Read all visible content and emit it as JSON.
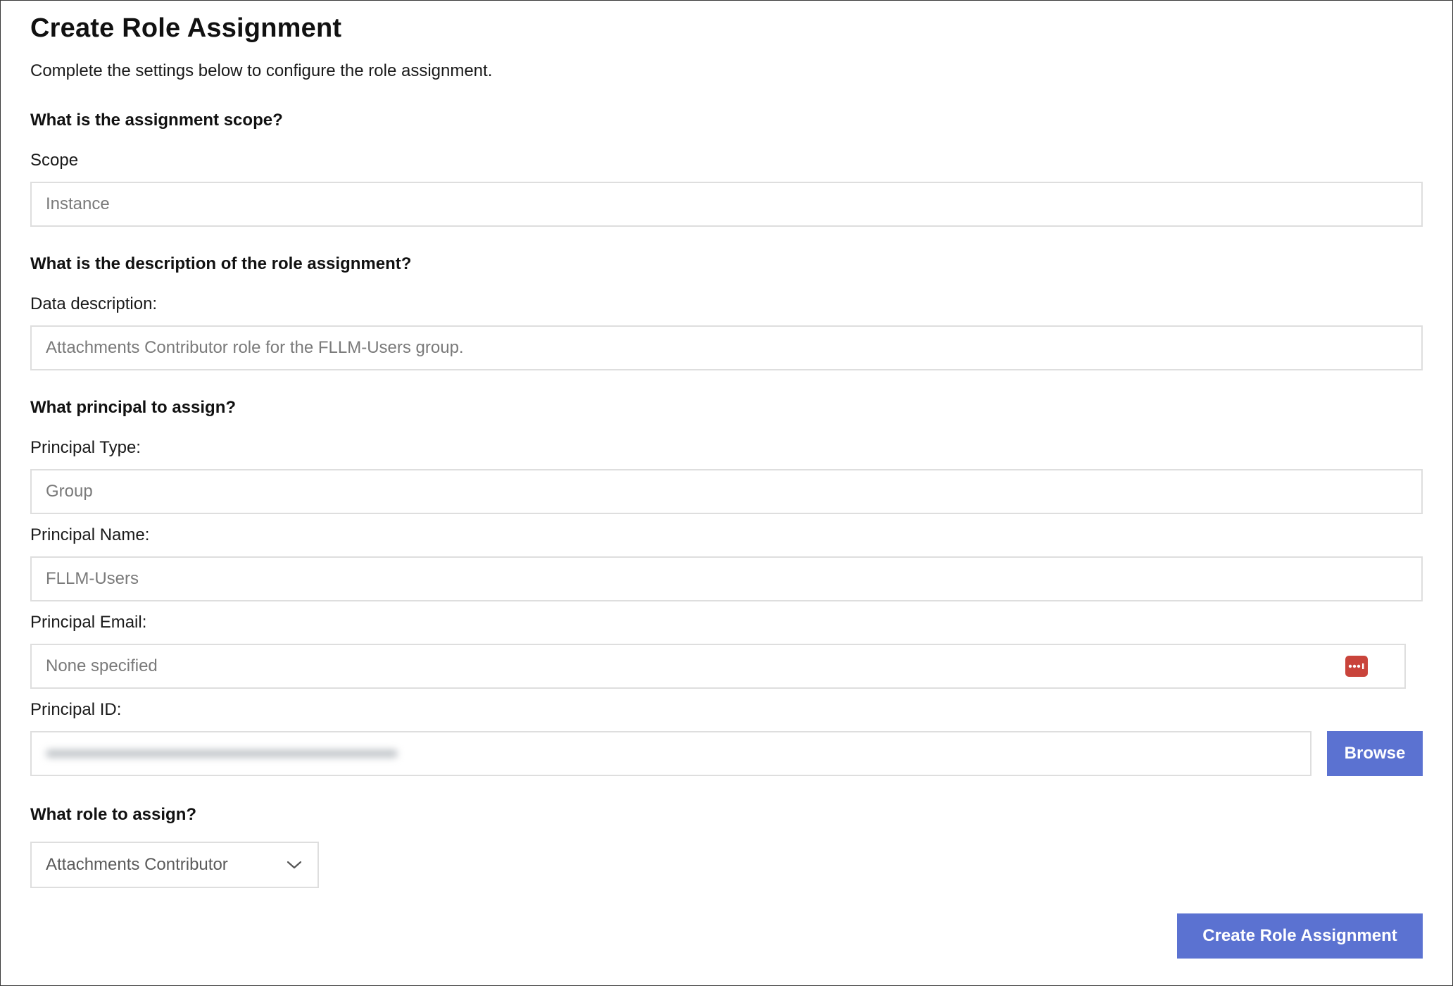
{
  "page": {
    "title": "Create Role Assignment",
    "subtitle": "Complete the settings below to configure the role assignment."
  },
  "scope_section": {
    "heading": "What is the assignment scope?",
    "scope_label": "Scope",
    "scope_value": "Instance"
  },
  "description_section": {
    "heading": "What is the description of the role assignment?",
    "description_label": "Data description:",
    "description_value": "Attachments Contributor role for the FLLM-Users group."
  },
  "principal_section": {
    "heading": "What principal to assign?",
    "type_label": "Principal Type:",
    "type_value": "Group",
    "name_label": "Principal Name:",
    "name_value": "FLLM-Users",
    "email_label": "Principal Email:",
    "email_placeholder": "None specified",
    "email_icon": "password-manager-icon",
    "id_label": "Principal ID:",
    "browse_label": "Browse"
  },
  "role_section": {
    "heading": "What role to assign?",
    "role_value": "Attachments Contributor"
  },
  "actions": {
    "submit_label": "Create Role Assignment"
  },
  "colors": {
    "accent": "#5b72d1",
    "password_icon": "#c9443b",
    "input_border": "#dedede"
  }
}
